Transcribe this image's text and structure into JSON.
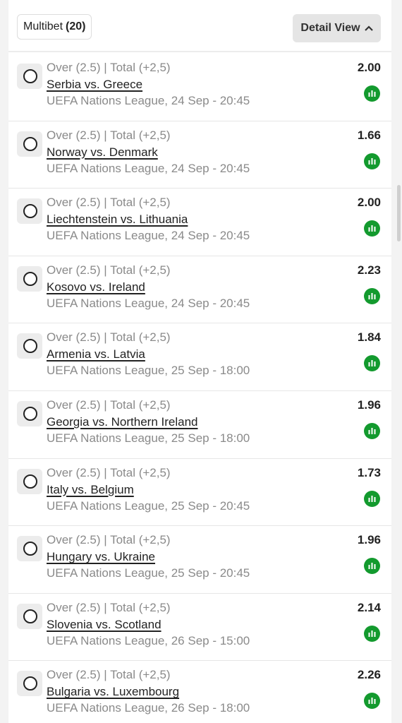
{
  "header": {
    "multibet_label": "Multibet",
    "multibet_count": "(20)",
    "detail_view_label": "Detail View",
    "detail_view_caret": "^"
  },
  "bets": [
    {
      "market": "Over (2.5) | Total (+2,5)",
      "match": "Serbia vs. Greece",
      "league": "UEFA Nations League, 24 Sep - 20:45",
      "odds": "2.00"
    },
    {
      "market": "Over (2.5) | Total (+2,5)",
      "match": "Norway vs. Denmark",
      "league": "UEFA Nations League, 24 Sep - 20:45",
      "odds": "1.66"
    },
    {
      "market": "Over (2.5) | Total (+2,5)",
      "match": "Liechtenstein vs. Lithuania",
      "league": "UEFA Nations League, 24 Sep - 20:45",
      "odds": "2.00"
    },
    {
      "market": "Over (2.5) | Total (+2,5)",
      "match": "Kosovo vs. Ireland",
      "league": "UEFA Nations League, 24 Sep - 20:45",
      "odds": "2.23"
    },
    {
      "market": "Over (2.5) | Total (+2,5)",
      "match": "Armenia vs. Latvia",
      "league": "UEFA Nations League, 25 Sep - 18:00",
      "odds": "1.84"
    },
    {
      "market": "Over (2.5) | Total (+2,5)",
      "match": "Georgia vs. Northern Ireland",
      "league": "UEFA Nations League, 25 Sep - 18:00",
      "odds": "1.96"
    },
    {
      "market": "Over (2.5) | Total (+2,5)",
      "match": "Italy vs. Belgium",
      "league": "UEFA Nations League, 25 Sep - 20:45",
      "odds": "1.73"
    },
    {
      "market": "Over (2.5) | Total (+2,5)",
      "match": "Hungary vs. Ukraine",
      "league": "UEFA Nations League, 25 Sep - 20:45",
      "odds": "1.96"
    },
    {
      "market": "Over (2.5) | Total (+2,5)",
      "match": "Slovenia vs. Scotland",
      "league": "UEFA Nations League, 26 Sep - 15:00",
      "odds": "2.14"
    },
    {
      "market": "Over (2.5) | Total (+2,5)",
      "match": "Bulgaria vs. Luxembourg",
      "league": "UEFA Nations League, 26 Sep - 18:00",
      "odds": "2.26"
    }
  ],
  "icons": {
    "radio": "radio-unchecked-icon",
    "stats": "stats-bar-chart-icon"
  },
  "colors": {
    "accent_green": "#139a2e",
    "text_primary": "#222222",
    "text_secondary": "#8a8a8a"
  }
}
